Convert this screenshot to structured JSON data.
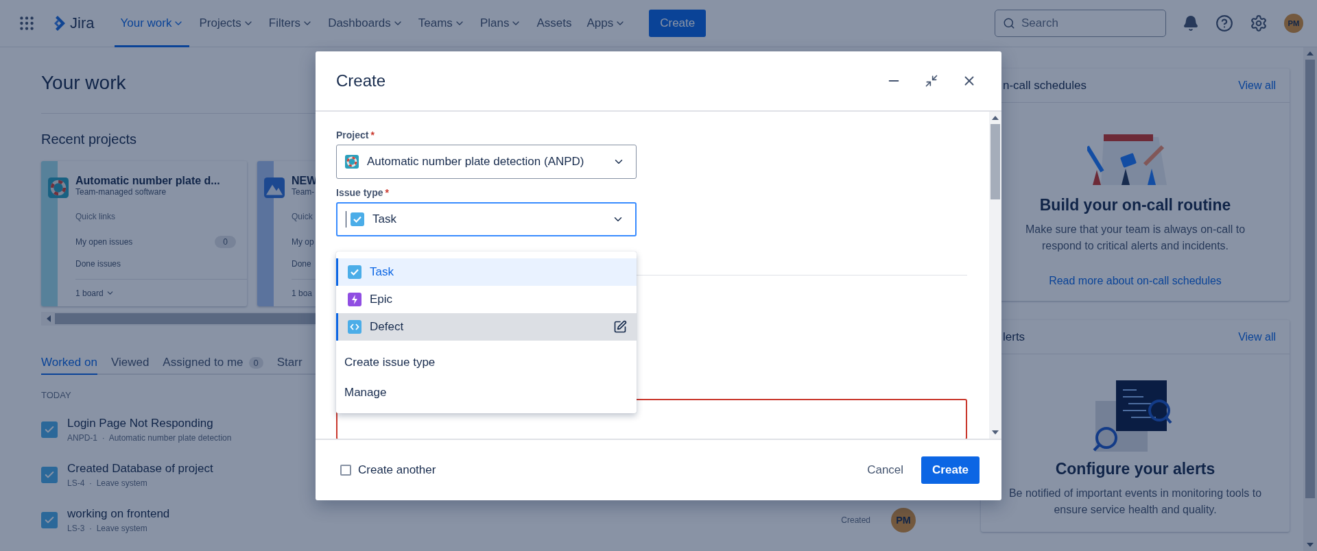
{
  "nav": {
    "app_name": "Jira",
    "items": [
      {
        "label": "Your work",
        "selected": true,
        "dropdown": true
      },
      {
        "label": "Projects",
        "selected": false,
        "dropdown": true
      },
      {
        "label": "Filters",
        "selected": false,
        "dropdown": true
      },
      {
        "label": "Dashboards",
        "selected": false,
        "dropdown": true
      },
      {
        "label": "Teams",
        "selected": false,
        "dropdown": true
      },
      {
        "label": "Plans",
        "selected": false,
        "dropdown": true
      },
      {
        "label": "Assets",
        "selected": false,
        "dropdown": false
      },
      {
        "label": "Apps",
        "selected": false,
        "dropdown": true
      }
    ],
    "create_button": "Create",
    "search": {
      "placeholder": "Search"
    },
    "avatar": "PM"
  },
  "page": {
    "title": "Your work",
    "recent_heading": "Recent projects",
    "projects": [
      {
        "name": "Automatic number plate d...",
        "type": "Team-managed software",
        "kind": "buoy",
        "quick_links": "Quick links",
        "links": [
          {
            "label": "My open issues",
            "count": "0"
          },
          {
            "label": "Done issues"
          }
        ],
        "boards": "1 board",
        "boards_menu": true
      },
      {
        "name": "NEW",
        "type": "Team-",
        "kind": "mountain",
        "quick_links": "Quick",
        "links": [
          {
            "label": "My op"
          },
          {
            "label": "Done"
          }
        ],
        "boards": "1 boa"
      }
    ],
    "tabs": [
      {
        "label": "Worked on",
        "selected": true
      },
      {
        "label": "Viewed",
        "selected": false
      },
      {
        "label": "Assigned to me",
        "count": "0",
        "selected": false
      },
      {
        "label": "Starr",
        "selected": false
      }
    ],
    "group": "TODAY",
    "items": [
      {
        "title": "Login Page Not Responding",
        "meta": "ANPD-1  ·  Automatic number plate detection"
      },
      {
        "title": "Created Database of project",
        "meta": "LS-4  ·  Leave system"
      },
      {
        "title": "working on frontend",
        "meta": "LS-3  ·  Leave system",
        "action": "Created",
        "avatar": "PM"
      }
    ]
  },
  "sidebar": {
    "cards": [
      {
        "title": "n-call schedules",
        "link": "View all",
        "kind": "calendar",
        "heading": "Build your on-call routine",
        "text": "Make sure that your team is always on-call to respond to critical alerts and incidents.",
        "more": "Read more about on-call schedules"
      },
      {
        "title": "lerts",
        "link": "View all",
        "kind": "alerts",
        "heading": "Configure your alerts",
        "text": "Be notified of important events in monitoring tools to ensure service health and quality."
      }
    ]
  },
  "modal": {
    "title": "Create",
    "fields": [
      {
        "label": "Project",
        "required_mark": "*",
        "value": "Automatic number plate detection (ANPD)",
        "kind": "buoy",
        "focused": false
      },
      {
        "label": "Issue type",
        "required_mark": "*",
        "value": "Task",
        "kind": "task",
        "focused": true
      }
    ],
    "menu": {
      "options": [
        {
          "label": "Task",
          "kind": "task",
          "selected": true,
          "hovered": false
        },
        {
          "label": "Epic",
          "kind": "epic",
          "selected": false,
          "hovered": false
        },
        {
          "label": "Defect",
          "kind": "defect",
          "selected": false,
          "hovered": true
        }
      ],
      "actions": [
        "Create issue type",
        "Manage"
      ]
    },
    "error_field": {
      "invalid": true
    },
    "create_another": {
      "label": "Create another",
      "checked": false
    },
    "cancel": "Cancel",
    "submit": "Create"
  }
}
